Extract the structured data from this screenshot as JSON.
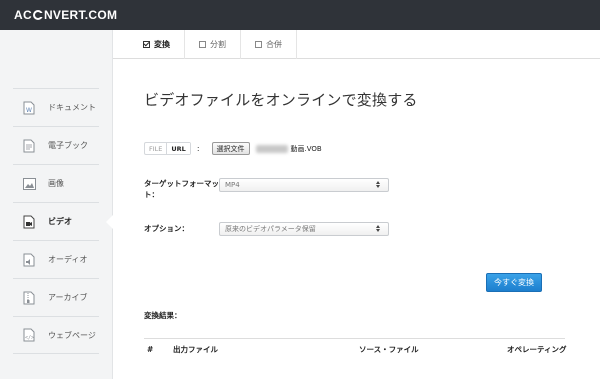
{
  "header": {
    "logo_prefix": "AC",
    "logo_suffix": "NVERT.COM"
  },
  "sidebar": {
    "items": [
      {
        "label": "ドキュメント",
        "icon": "document-icon"
      },
      {
        "label": "電子ブック",
        "icon": "ebook-icon"
      },
      {
        "label": "画像",
        "icon": "image-icon"
      },
      {
        "label": "ビデオ",
        "icon": "video-icon",
        "active": true
      },
      {
        "label": "オーディオ",
        "icon": "audio-icon"
      },
      {
        "label": "アーカイブ",
        "icon": "archive-icon"
      },
      {
        "label": "ウェブページ",
        "icon": "webpage-icon"
      }
    ]
  },
  "tabs": [
    {
      "label": "変換",
      "active": true
    },
    {
      "label": "分割"
    },
    {
      "label": "合併"
    }
  ],
  "main": {
    "title": "ビデオファイルをオンラインで変換する",
    "source_toggle": {
      "file": "FILE",
      "url": "URL"
    },
    "colon": ":",
    "choose_file_button": "選択文件",
    "file_name": "動画.VOB",
    "target_format": {
      "label": "ターゲットフォーマット：",
      "value": "MP4"
    },
    "options": {
      "label": "オプション：",
      "value": "原来のビデオパラメータ保留"
    },
    "convert_button": "今すぐ変換",
    "results_label": "変換結果：",
    "table_headers": {
      "num": "#",
      "output": "出力ファイル",
      "source": "ソース・ファイル",
      "operation": "オペレーティング"
    }
  },
  "colors": {
    "topbar": "#2f3339",
    "sidebar": "#f3f4f5",
    "accent": "#2a8fdc"
  }
}
